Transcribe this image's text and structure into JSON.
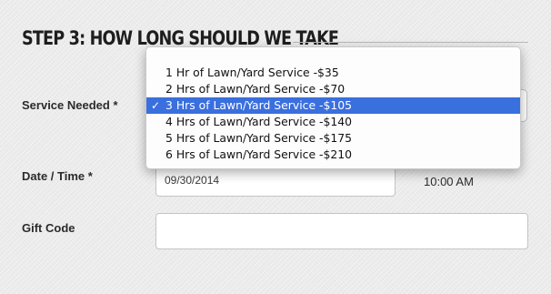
{
  "step": {
    "title": "STEP 3: HOW LONG SHOULD WE TAKE"
  },
  "form": {
    "service_label": "Service Needed *",
    "date_label": "Date / Time *",
    "date_value": "09/30/2014",
    "time_value": "10:00 AM",
    "gift_label": "Gift Code",
    "gift_value": ""
  },
  "service_options": {
    "selected_index": 2,
    "items": [
      "1 Hr of Lawn/Yard Service -$35",
      "2 Hrs of Lawn/Yard Service -$70",
      "3 Hrs of Lawn/Yard Service -$105",
      "4 Hrs of Lawn/Yard Service -$140",
      "5 Hrs of Lawn/Yard Service -$175",
      "6 Hrs of Lawn/Yard Service -$210"
    ]
  },
  "icons": {
    "selected_marker": "checkmark-icon",
    "select_control": "updown-arrows-icon"
  },
  "colors": {
    "highlight": "#3a6fde",
    "background": "#ececec"
  }
}
